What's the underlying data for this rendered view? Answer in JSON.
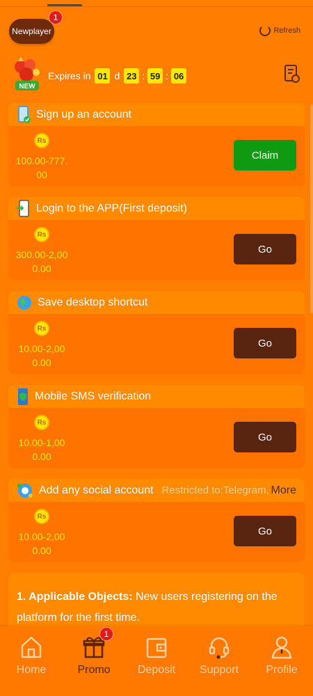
{
  "header": {
    "tab_label": "Newplayer",
    "tab_badge": "1",
    "refresh_label": "Refresh"
  },
  "timer": {
    "new_label": "NEW",
    "expires_label": "Expires in",
    "days": "01",
    "day_unit": "d",
    "hours": "23",
    "minutes": "59",
    "seconds": "06",
    "sep": ":"
  },
  "tasks": [
    {
      "title": "Sign up an account",
      "coin": "Rs",
      "amount_line1": "100.00-777.",
      "amount_line2": "00",
      "button": "Claim"
    },
    {
      "title": "Login to the APP(First deposit)",
      "coin": "Rs",
      "amount_line1": "300.00-2,00",
      "amount_line2": "0.00",
      "button": "Go"
    },
    {
      "title": "Save desktop shortcut",
      "coin": "Rs",
      "amount_line1": "10.00-2,00",
      "amount_line2": "0.00",
      "button": "Go"
    },
    {
      "title": "Mobile SMS verification",
      "coin": "Rs",
      "amount_line1": "10.00-1,00",
      "amount_line2": "0.00",
      "button": "Go"
    },
    {
      "title": "Add any social account",
      "restricted": "Restricted to:Telegram, Fa...",
      "more": "More",
      "coin": "Rs",
      "amount_line1": "10.00-2,00",
      "amount_line2": "0.00",
      "button": "Go"
    }
  ],
  "rules": {
    "heading": "1. Applicable Objects:",
    "text": " New users registering on the platform for the first time."
  },
  "nav": {
    "items": [
      {
        "label": "Home"
      },
      {
        "label": "Promo",
        "badge": "1"
      },
      {
        "label": "Deposit"
      },
      {
        "label": "Support"
      },
      {
        "label": "Profile"
      }
    ],
    "active_color": "#5A2510",
    "inactive_color": "#FFD1A0"
  },
  "colors": {
    "background": "#FF7D00",
    "claim": "#0E9B12",
    "go": "#5A2510",
    "coin": "#FFE600"
  }
}
